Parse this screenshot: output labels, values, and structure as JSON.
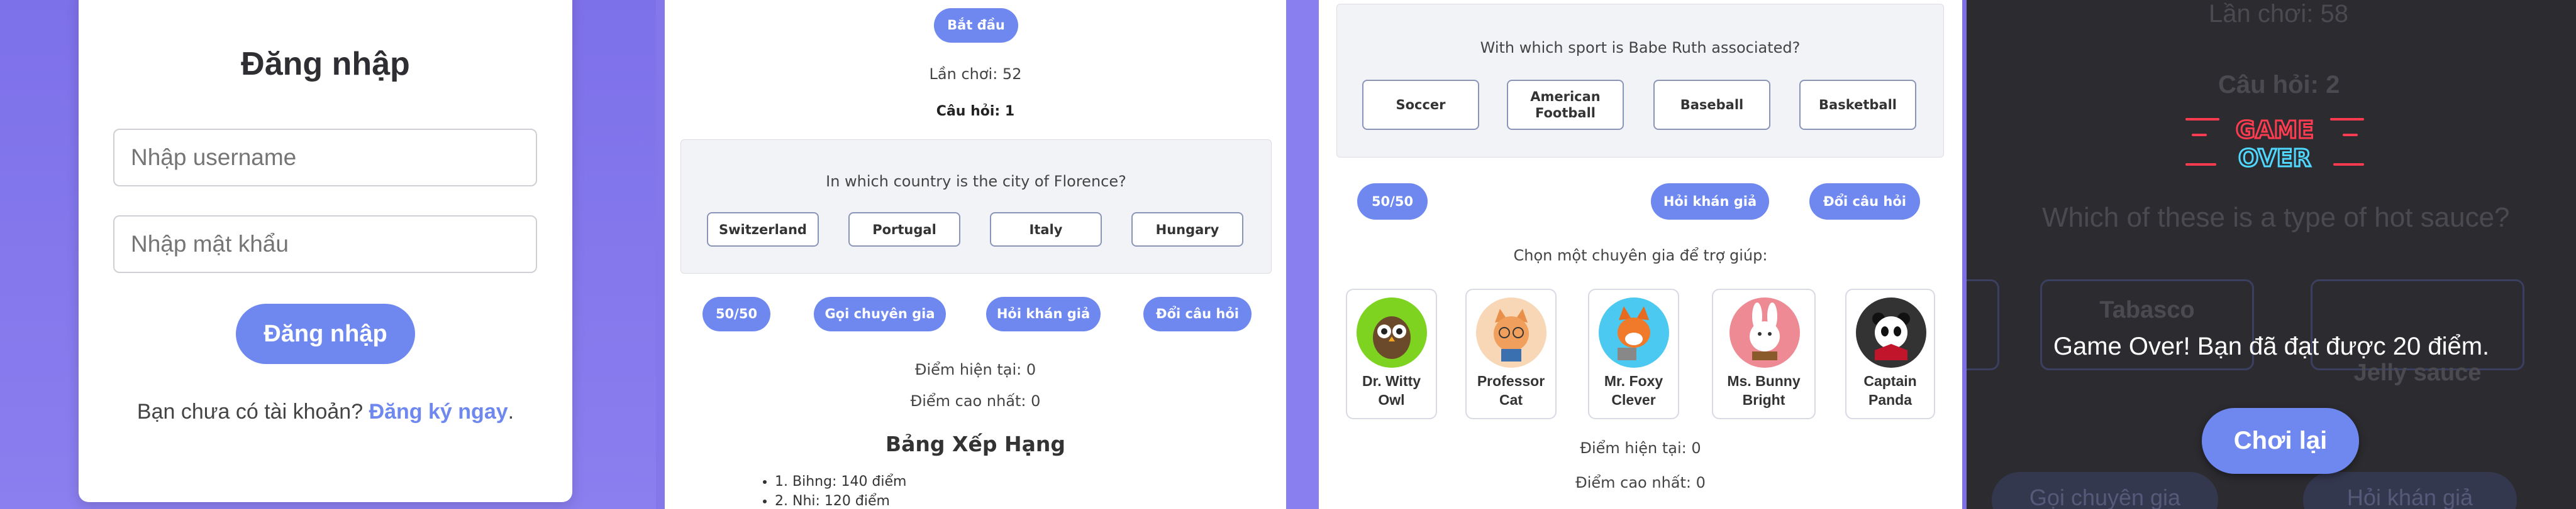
{
  "login": {
    "title": "Đăng nhập",
    "username_placeholder": "Nhập username",
    "password_placeholder": "Nhập mật khẩu",
    "submit_label": "Đăng nhập",
    "footer_text": "Bạn chưa có tài khoản?",
    "register_link": "Đăng ký ngay",
    "footer_period": "."
  },
  "quiz1": {
    "start_label": "Bắt đầu",
    "plays": "Lần chơi: 52",
    "question_no": "Câu hỏi: 1",
    "question": "In which country is the city of Florence?",
    "options": [
      "Switzerland",
      "Portugal",
      "Italy",
      "Hungary"
    ],
    "lifelines": [
      "50/50",
      "Gọi chuyên gia",
      "Hỏi khán giả",
      "Đổi câu hỏi"
    ],
    "current_score": "Điểm hiện tại: 0",
    "high_score": "Điểm cao nhất: 0",
    "leaderboard_title": "Bảng Xếp Hạng",
    "leaderboard": [
      "1. Bihng: 140 điểm",
      "2. Nhi: 120 điểm"
    ]
  },
  "quiz2": {
    "question": "With which sport is Babe Ruth associated?",
    "options": [
      "Soccer",
      "American Football",
      "Baseball",
      "Basketball"
    ],
    "lifelines": [
      "50/50",
      "Hỏi khán giả",
      "Đổi câu hỏi"
    ],
    "expert_prompt": "Chọn một chuyên gia để trợ giúp:",
    "experts": [
      {
        "name": "Dr. Witty Owl",
        "icon": "owl-icon",
        "color": "#7ed321"
      },
      {
        "name": "Professor Cat",
        "icon": "cat-icon",
        "color": "#f7d7b5"
      },
      {
        "name": "Mr. Foxy Clever",
        "icon": "fox-icon",
        "color": "#4cc9f0"
      },
      {
        "name": "Ms. Bunny Bright",
        "icon": "bunny-icon",
        "color": "#ee8a94"
      },
      {
        "name": "Captain Panda",
        "icon": "panda-icon",
        "color": "#333333"
      }
    ],
    "current_score": "Điểm hiện tại: 0",
    "high_score": "Điểm cao nhất: 0"
  },
  "gameover": {
    "plays": "Lần chơi: 58",
    "question_no": "Câu hỏi: 2",
    "logo_line1": "GAME",
    "logo_line2": "OVER",
    "question": "Which of these is a type of hot sauce?",
    "options": [
      "Tabasco",
      "Jelly sauce"
    ],
    "message": "Game Over! Bạn đã đạt được 20 điểm.",
    "retry_label": "Chơi lại",
    "lifelines": [
      "Gọi chuyên gia",
      "Hỏi khán giả"
    ]
  },
  "colors": {
    "accent": "#6e88f0",
    "background": "#8a7fef",
    "overlay": "#2c2c30",
    "neon_red": "#ff3b4f",
    "neon_cyan": "#4fd8ff"
  }
}
